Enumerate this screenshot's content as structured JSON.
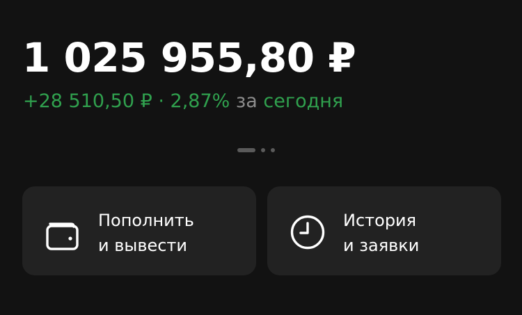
{
  "balance": {
    "amount": "1 025 955,80 ₽"
  },
  "daily_change": {
    "amount": "+28 510,50 ₽ · 2,87%",
    "connector": "за",
    "period": "сегодня"
  },
  "pager": {
    "pages": 3,
    "active_page": 1
  },
  "actions": [
    {
      "icon": "wallet-icon",
      "line1": "Пополнить",
      "line2": "и вывести"
    },
    {
      "icon": "clock-icon",
      "line1": "История",
      "line2": "и заявки"
    }
  ],
  "colors": {
    "background": "#121212",
    "card": "#222222",
    "positive": "#30a14e",
    "muted": "#8c8c8c",
    "text": "#ffffff"
  }
}
